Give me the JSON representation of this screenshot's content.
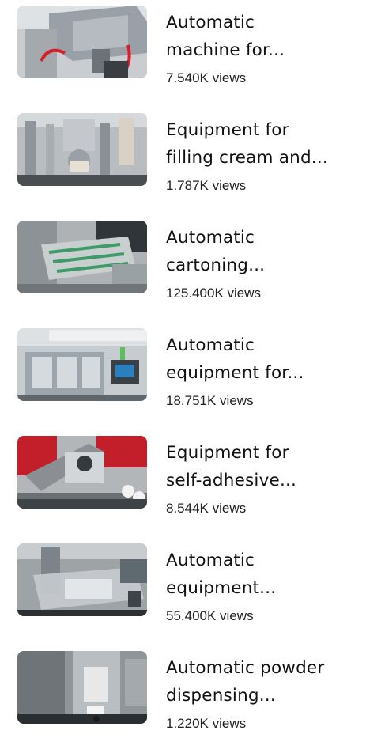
{
  "videos": [
    {
      "title_line1": "Automatic",
      "title_line2": "machine for...",
      "views": "7.540K views",
      "thumb_icon": "stainless-machine-thumbnail",
      "palette": {
        "bg": "#c9cdd2",
        "main": "#8e949b",
        "accent": "#d81e2a",
        "dark": "#3a3d42"
      }
    },
    {
      "title_line1": "Equipment for",
      "title_line2": "filling cream and...",
      "views": "1.787K views",
      "thumb_icon": "tube-filling-machine-thumbnail",
      "palette": {
        "bg": "#b9bcc0",
        "main": "#9aa0a6",
        "accent": "#d8d2c6",
        "dark": "#4a4d52"
      }
    },
    {
      "title_line1": "Automatic",
      "title_line2": "cartoning...",
      "views": "125.400K views",
      "thumb_icon": "cartoning-machine-thumbnail",
      "palette": {
        "bg": "#aeb2b4",
        "main": "#7f8f88",
        "accent": "#3f9a6a",
        "dark": "#2f3538"
      }
    },
    {
      "title_line1": "Automatic",
      "title_line2": "equipment for...",
      "views": "18.751K views",
      "thumb_icon": "enclosed-equipment-thumbnail",
      "palette": {
        "bg": "#c7ccd0",
        "main": "#9ea6ad",
        "accent": "#2a7fbf",
        "dark": "#3b4045"
      }
    },
    {
      "title_line1": "Equipment for",
      "title_line2": "self-adhesive...",
      "views": "8.544K views",
      "thumb_icon": "labeling-machine-thumbnail",
      "palette": {
        "bg": "#b3b6b8",
        "main": "#8b8f93",
        "accent": "#c21f2b",
        "dark": "#353a3e"
      }
    },
    {
      "title_line1": "Automatic",
      "title_line2": "equipment...",
      "views": "55.400K views",
      "thumb_icon": "transparent-enclosure-machine-thumbnail",
      "palette": {
        "bg": "#9ea3a6",
        "main": "#c6cbcf",
        "accent": "#5e6a70",
        "dark": "#2c3033"
      }
    },
    {
      "title_line1": "Automatic powder",
      "title_line2": "dispensing...",
      "views": "1.220K views",
      "thumb_icon": "powder-dispensing-machine-thumbnail",
      "palette": {
        "bg": "#8f9599",
        "main": "#b8bec2",
        "accent": "#e8e8e8",
        "dark": "#2a2e31"
      }
    }
  ]
}
